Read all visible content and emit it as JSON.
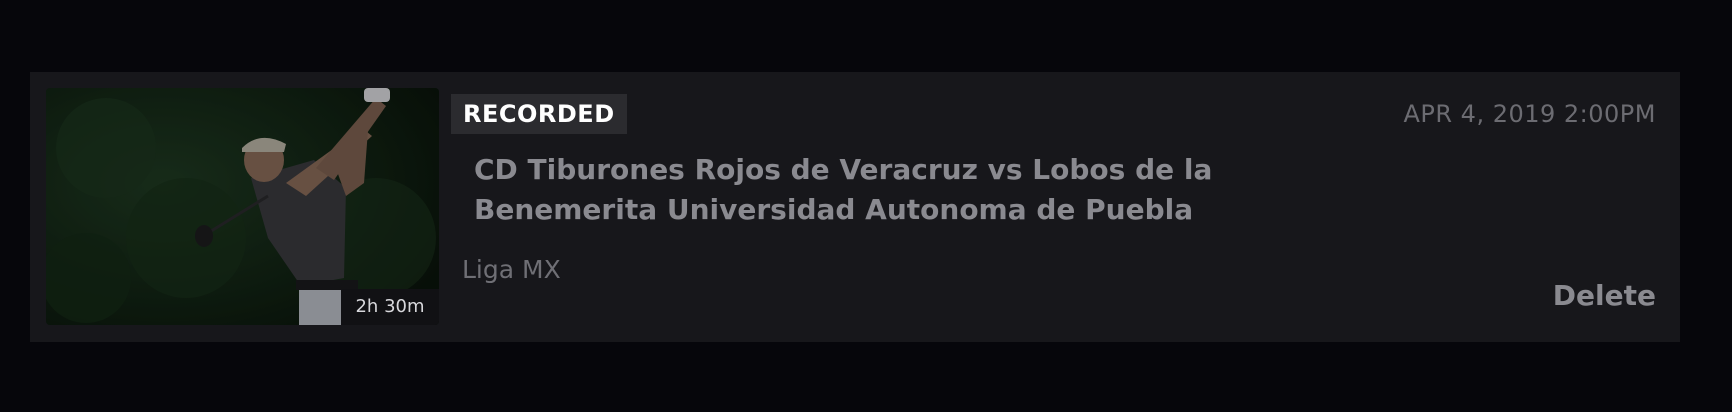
{
  "recording": {
    "badge": "RECORDED",
    "datetime": "APR 4, 2019 2:00PM",
    "title": "CD Tiburones Rojos de Veracruz vs Lobos de la Benemerita Universidad Autonoma de Puebla",
    "league": "Liga MX",
    "duration": "2h 30m",
    "delete_label": "Delete"
  },
  "colors": {
    "page_background": "#06060b",
    "card_background": "#17171b",
    "badge_background": "#2b2b2f",
    "muted_text": "#8a8a90"
  },
  "thumbnail": {
    "subject": "golfer-swinging"
  }
}
